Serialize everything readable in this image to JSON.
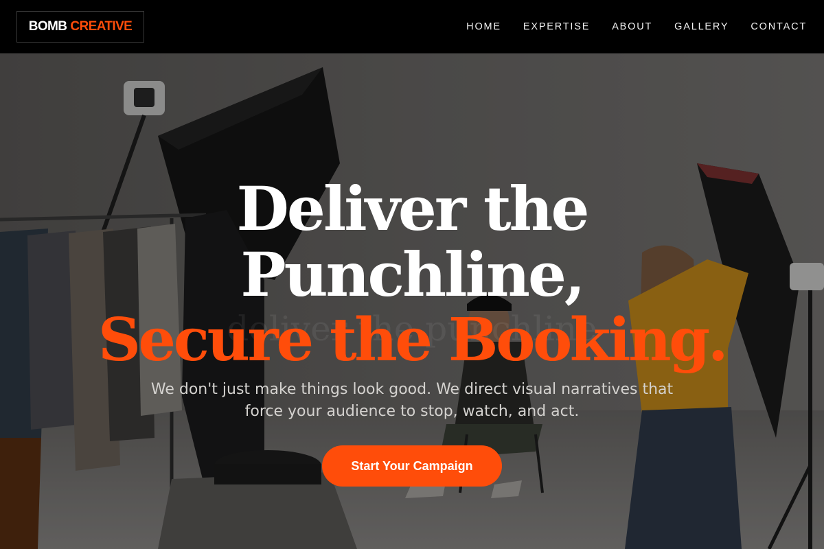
{
  "brand": {
    "logo_word1": "BOMB",
    "logo_word2": "CREATIVE",
    "accent_color": "#ff4d0a"
  },
  "nav": {
    "items": [
      {
        "label": "HOME"
      },
      {
        "label": "EXPERTISE"
      },
      {
        "label": "ABOUT"
      },
      {
        "label": "GALLERY"
      },
      {
        "label": "CONTACT"
      }
    ]
  },
  "hero": {
    "headline_line1": "Deliver the",
    "headline_line2": "Punchline,",
    "headline_line3": "Secure the Booking.",
    "ghost_text": "deliver the punchline",
    "subtitle": "We don't just make things look good. We direct visual narratives that force your audience to stop, watch, and act.",
    "cta_label": "Start Your Campaign",
    "background_image": "photo-studio-scene"
  }
}
